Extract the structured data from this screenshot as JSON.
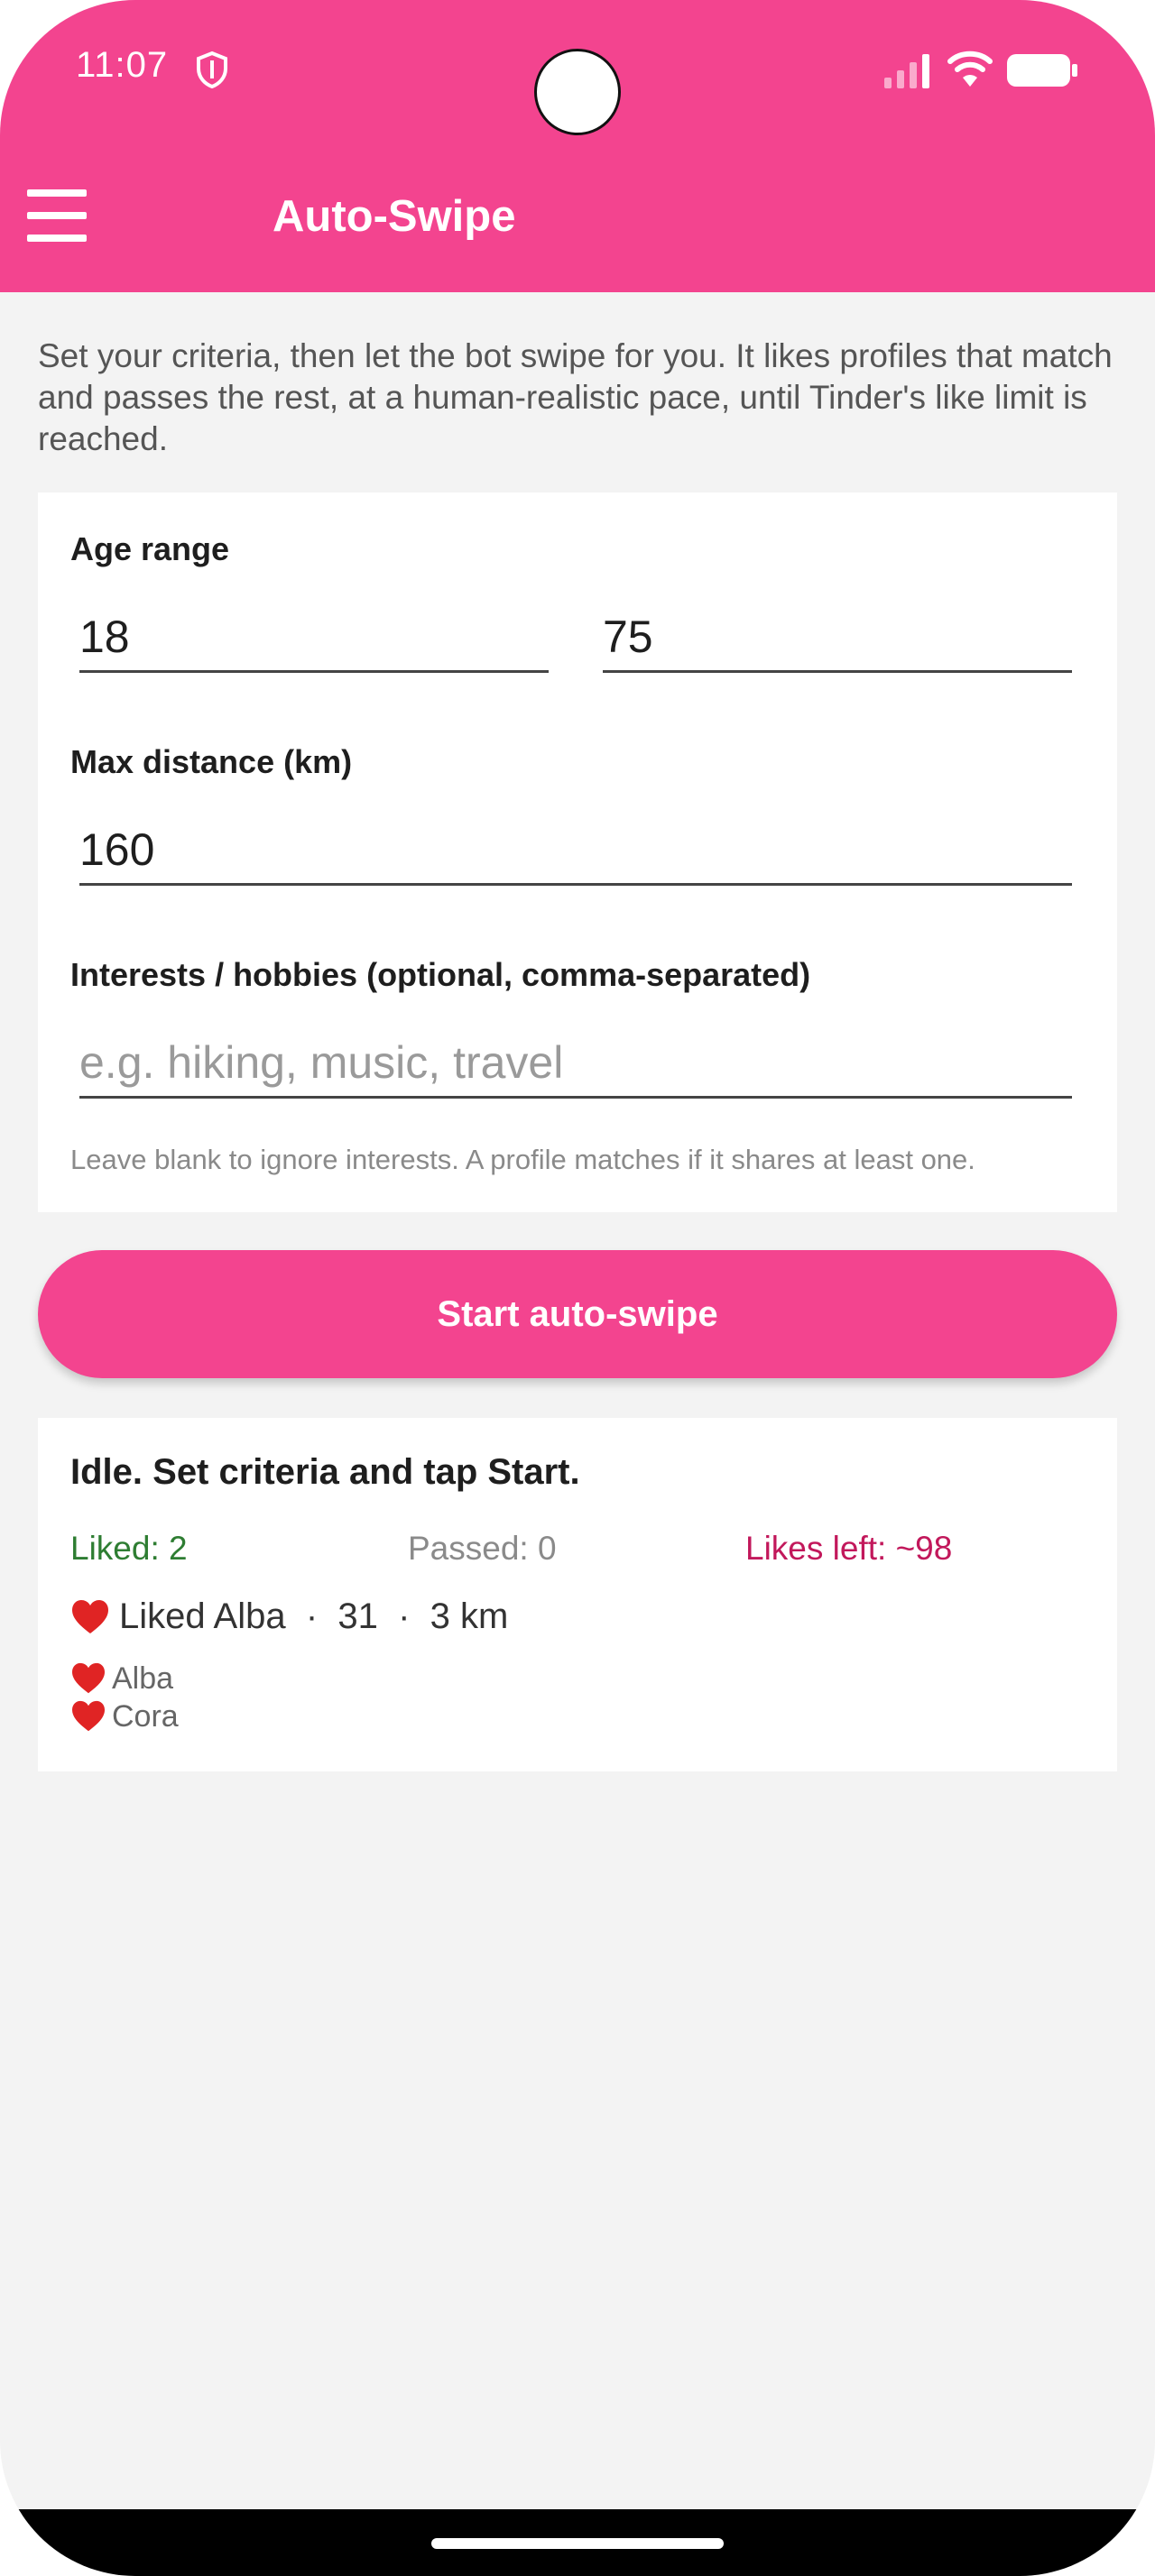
{
  "status_bar": {
    "time": "11:07",
    "icons": [
      "shield-icon",
      "signal-icon",
      "wifi-icon",
      "battery-icon"
    ]
  },
  "app_bar": {
    "title": "Auto-Swipe",
    "menu_icon": "hamburger-menu-icon"
  },
  "intro": "Set your criteria, then let the bot swipe for you. It likes profiles that match and passes the rest, at a human-realistic pace, until Tinder's like limit is reached.",
  "criteria": {
    "age_label": "Age range",
    "age_min": "18",
    "age_max": "75",
    "distance_label": "Max distance (km)",
    "distance_value": "160",
    "interests_label": "Interests / hobbies (optional, comma-separated)",
    "interests_value": "",
    "interests_placeholder": "e.g. hiking, music, travel",
    "interests_hint": "Leave blank to ignore interests. A profile matches if it shares at least one."
  },
  "start_button": "Start auto-swipe",
  "status": {
    "message": "Idle. Set criteria and tap Start.",
    "liked": "Liked: 2",
    "passed": "Passed: 0",
    "likes_left": "Likes left: ~98",
    "last_action": "Liked Alba  ·  31  ·  3 km",
    "liked_profiles": [
      "Alba",
      "Cora"
    ]
  },
  "colors": {
    "accent": "#f3448f",
    "liked": "#2e7d32",
    "passed": "#8a8a8a",
    "likes_left": "#c2185b",
    "heart": "#e02424"
  }
}
